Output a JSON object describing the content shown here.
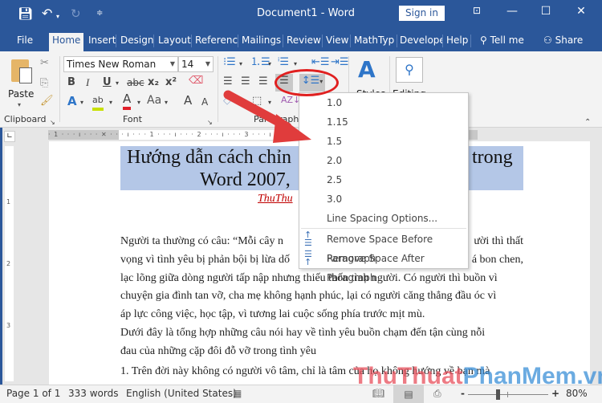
{
  "titlebar": {
    "title": "Document1  -  Word",
    "sign_in": "Sign in",
    "icons": [
      "save-icon",
      "undo-icon",
      "redo-icon",
      "customize-qat-icon",
      "ribbon-display-icon",
      "minimize-icon",
      "maximize-icon",
      "close-icon"
    ]
  },
  "tabs": [
    {
      "label": "File"
    },
    {
      "label": "Home",
      "active": true
    },
    {
      "label": "Insert"
    },
    {
      "label": "Design"
    },
    {
      "label": "Layout"
    },
    {
      "label": "Reference"
    },
    {
      "label": "Mailings"
    },
    {
      "label": "Review"
    },
    {
      "label": "View"
    },
    {
      "label": "MathTyp"
    },
    {
      "label": "Develope"
    },
    {
      "label": "Help"
    }
  ],
  "tell_me": "Tell me",
  "share": "Share",
  "ribbon": {
    "clipboard": {
      "label": "Clipboard",
      "paste": "Paste"
    },
    "font": {
      "label": "Font",
      "font_name": "Times New Roman",
      "font_size": "14",
      "bold": "B",
      "italic": "I",
      "underline": "U",
      "strike": "abc",
      "subscript": "x₂",
      "superscript": "x²",
      "case": "Aa",
      "grow": "A",
      "shrink": "A"
    },
    "paragraph": {
      "label": "Paragraph"
    },
    "styles": {
      "label": "Styles"
    },
    "editing": {
      "label": "Editing"
    }
  },
  "ruler": {
    "h_marks": "· 1 · · · ı · · · ✕ · · · ı · · · 1 · · · ı · · · 2 · · · ı · · · 3 · · · ı · · · 4 · · · ı · · · 5 · · · ı · · · 6 · · · △ · · · 7",
    "v_marks": [
      "1",
      "2",
      "3"
    ]
  },
  "line_spacing_menu": {
    "items": [
      "1.0",
      "1.15",
      "1.5",
      "2.0",
      "2.5",
      "3.0"
    ],
    "options": "Line Spacing Options...",
    "remove_before": "Remove Space Before Paragraph",
    "remove_after": "Remove Space After Paragraph"
  },
  "document": {
    "title_line1_left": "Hướng dẫn cách chỉn",
    "title_line1_right": "trong",
    "title_line2": "Word 2007,",
    "author": "ThuThu",
    "paragraphs": [
      {
        "left": "Người ta thường có câu: “Mỗi cây n",
        "right": "ười thì thất"
      },
      {
        "left": "vọng vì tình yêu bị phản bội bị lừa dố",
        "right": "á bon chen,"
      },
      {
        "left": "lạc lõng giữa dòng người tấp nập nhưng thiếu thốn tình người. Có người thì buồn vì",
        "right": ""
      },
      {
        "left": "chuyện gia đình tan vỡ, cha mẹ không hạnh phúc, lại có người căng thẳng đầu óc vì",
        "right": ""
      },
      {
        "left": "áp lực công việc, học tập, vì tương lai cuộc sống phía trước mịt mù.",
        "right": ""
      },
      {
        "left": "Dưới đây là tổng hợp những câu nói hay về tình yêu buồn chạm đến tận cùng nỗi",
        "right": ""
      },
      {
        "left": "đau của những cặp đôi đỗ vỡ trong tình yêu",
        "right": ""
      },
      {
        "left": "1. Trên đời này không có người vô tâm, chỉ là tâm của họ không hướng về bạn mà",
        "right": ""
      }
    ]
  },
  "status": {
    "page": "Page 1 of 1",
    "words": "333 words",
    "language": "English (United States)",
    "zoom_minus": "-",
    "zoom_plus": "+",
    "zoom": "80%",
    "zoom_percent": 80
  },
  "watermark": {
    "part1": "ThuThuat",
    "part2": "PhanMem",
    "part3": ".vn"
  },
  "colors": {
    "brand": "#2b579a",
    "highlight": "#b4c7e7",
    "annotation": "#e02020",
    "author": "#c00000"
  }
}
